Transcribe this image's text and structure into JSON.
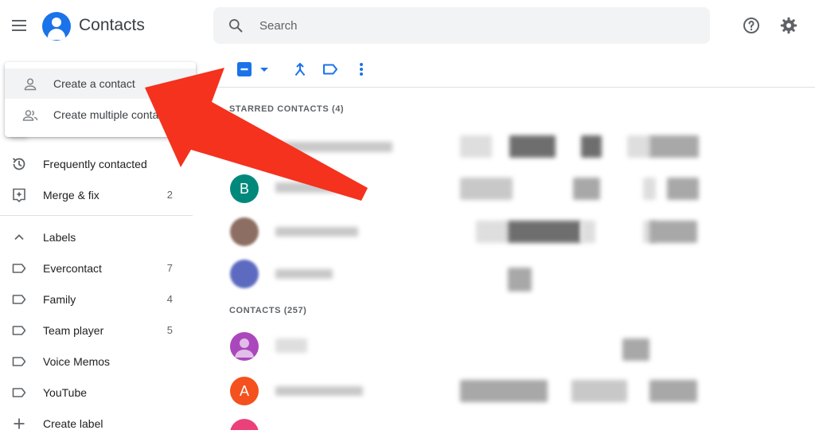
{
  "header": {
    "app_title": "Contacts",
    "search_placeholder": "Search",
    "icons": [
      "menu-icon",
      "contacts-logo-icon",
      "search-icon",
      "help-icon",
      "settings-icon"
    ]
  },
  "create_menu": {
    "items": [
      {
        "label": "Create a contact",
        "icon": "person-icon"
      },
      {
        "label": "Create multiple contacts",
        "icon": "people-icon"
      }
    ]
  },
  "sidebar": {
    "items": [
      {
        "label": "Frequently contacted",
        "icon": "history-icon",
        "count": ""
      },
      {
        "label": "Merge & fix",
        "icon": "merge-fix-icon",
        "count": "2"
      }
    ],
    "labels_header": "Labels",
    "labels": [
      {
        "label": "Evercontact",
        "count": "7"
      },
      {
        "label": "Family",
        "count": "4"
      },
      {
        "label": "Team player",
        "count": "5"
      },
      {
        "label": "Voice Memos",
        "count": ""
      },
      {
        "label": "YouTube",
        "count": ""
      }
    ],
    "create_label": "Create label"
  },
  "toolbar": {
    "icons": [
      "select-checkbox-icon",
      "dropdown-arrow-icon",
      "merge-icon",
      "label-icon",
      "more-vert-icon"
    ]
  },
  "content": {
    "starred_header": "STARRED CONTACTS (4)",
    "contacts_header": "CONTACTS (257)",
    "starred_avatars": [
      {
        "letter": "",
        "color": "#9e9e9e"
      },
      {
        "letter": "B",
        "color": "#00897b"
      },
      {
        "letter": "",
        "color": "#8d6e63"
      },
      {
        "letter": "",
        "color": "#5c6bc0"
      }
    ],
    "contact_avatars": [
      {
        "letter": "",
        "color": "#ab47bc"
      },
      {
        "letter": "A",
        "color": "#f4511e"
      },
      {
        "letter": "",
        "color": "#ec407a"
      }
    ]
  },
  "colors": {
    "accent": "#1a73e8",
    "annotation_arrow": "#f4321e"
  }
}
